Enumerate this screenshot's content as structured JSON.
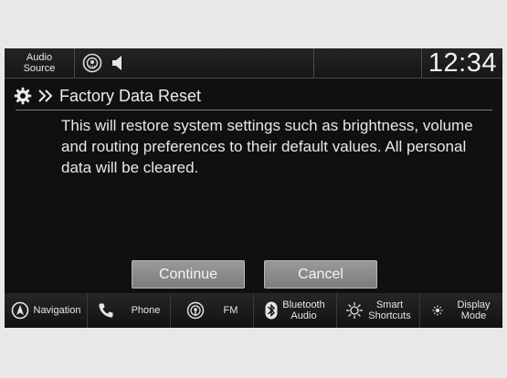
{
  "status_bar": {
    "audio_source_line1": "Audio",
    "audio_source_line2": "Source",
    "clock": "12:34"
  },
  "dialog": {
    "title": "Factory Data Reset",
    "message": "This will restore system settings such as brightness, volume and routing preferences to their default values. All personal data will be cleared.",
    "continue_label": "Continue",
    "cancel_label": "Cancel"
  },
  "nav": {
    "navigation": "Navigation",
    "phone": "Phone",
    "fm": "FM",
    "bluetooth_line1": "Bluetooth",
    "bluetooth_line2": "Audio",
    "smart_line1": "Smart",
    "smart_line2": "Shortcuts",
    "display_line1": "Display",
    "display_line2": "Mode"
  },
  "icons": {
    "settings": "gear-icon",
    "breadcrumb": "double-chevron-icon",
    "fm_status": "fm-broadcast-icon",
    "volume": "speaker-icon",
    "navigation": "compass-icon",
    "phone": "phone-icon",
    "fm": "radio-icon",
    "bluetooth": "bluetooth-icon",
    "smart_shortcuts": "sparkle-icon",
    "display_mode": "sun-moon-icon"
  }
}
